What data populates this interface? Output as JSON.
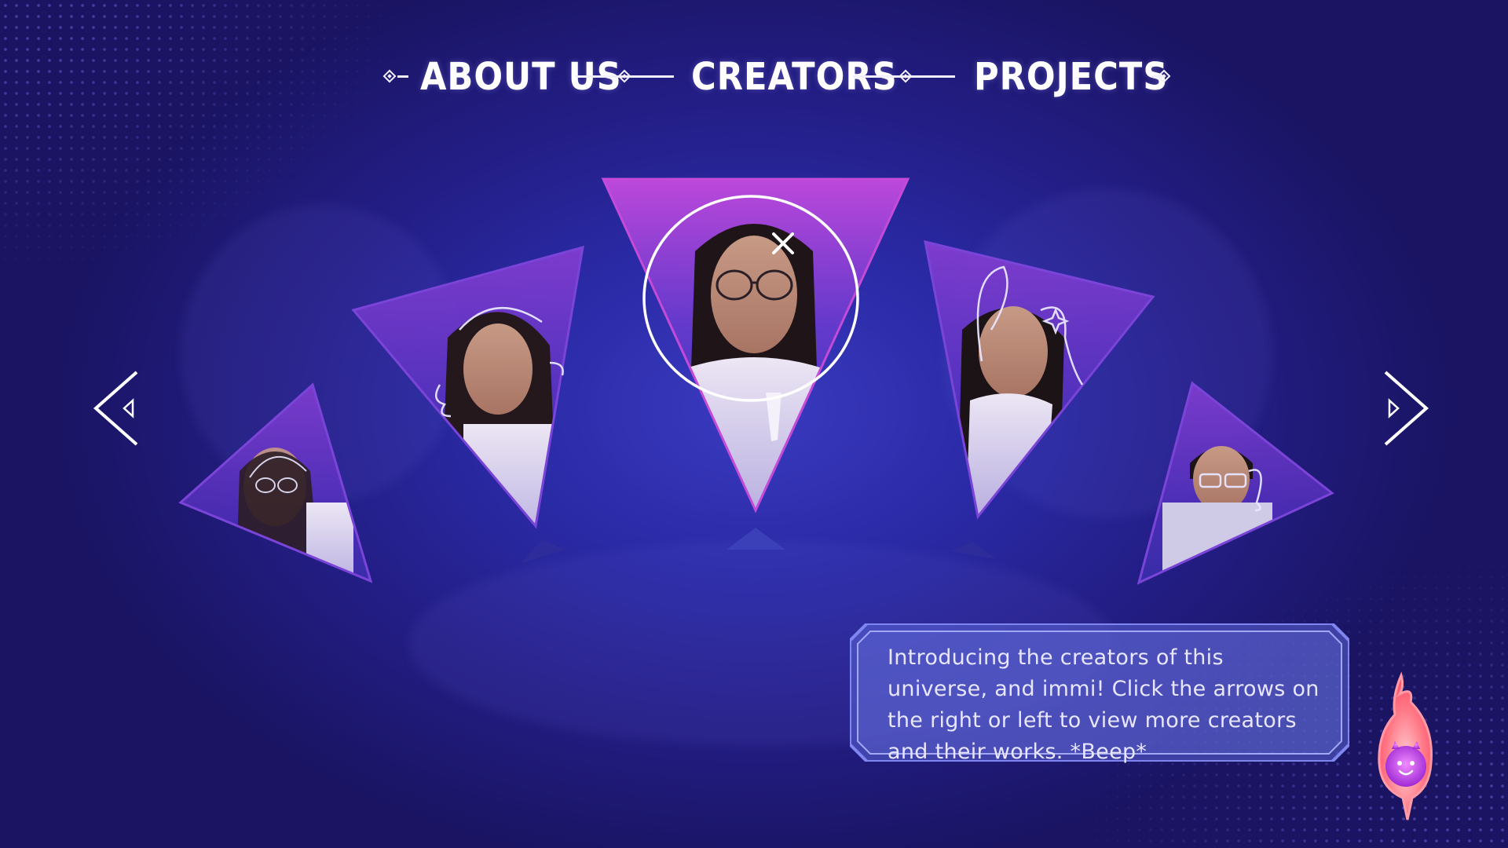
{
  "nav": {
    "items": [
      {
        "label": "ABOUT US"
      },
      {
        "label": "CREATORS"
      },
      {
        "label": "PROJECTS"
      }
    ]
  },
  "carousel": {
    "icons": {
      "prev": "chevron-left-icon",
      "next": "chevron-right-icon",
      "close": "close-icon"
    },
    "creators": [
      {
        "name": "creator-far-left",
        "icon": "avatar"
      },
      {
        "name": "creator-left",
        "icon": "avatar"
      },
      {
        "name": "creator-center",
        "icon": "avatar",
        "selected": true
      },
      {
        "name": "creator-right",
        "icon": "avatar"
      },
      {
        "name": "creator-far-right",
        "icon": "avatar"
      }
    ]
  },
  "dialog": {
    "text": "Introducing the creators of this universe, and immi! Click the arrows on the right or left to view more creators and their works. *Beep*"
  },
  "mascot": {
    "icon": "flame-mascot-icon"
  },
  "colors": {
    "background": "#2a2aa6",
    "accent": "#c44ad8",
    "text": "#ffffff",
    "dialog_border": "#7f86f0",
    "mascot": "#ff6a7a"
  }
}
